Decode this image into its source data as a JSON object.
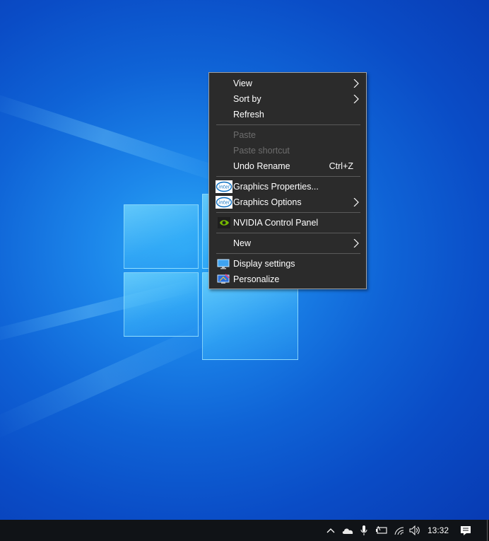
{
  "context_menu": {
    "items": [
      {
        "label": "View",
        "has_submenu": true,
        "enabled": true
      },
      {
        "label": "Sort by",
        "has_submenu": true,
        "enabled": true
      },
      {
        "label": "Refresh",
        "enabled": true
      },
      {
        "label": "Paste",
        "enabled": false
      },
      {
        "label": "Paste shortcut",
        "enabled": false
      },
      {
        "label": "Undo Rename",
        "accelerator": "Ctrl+Z",
        "enabled": true
      },
      {
        "label": "Graphics Properties...",
        "icon": "intel-icon",
        "enabled": true
      },
      {
        "label": "Graphics Options",
        "icon": "intel-icon",
        "has_submenu": true,
        "enabled": true
      },
      {
        "label": "NVIDIA Control Panel",
        "icon": "nvidia-icon",
        "enabled": true
      },
      {
        "label": "New",
        "has_submenu": true,
        "enabled": true
      },
      {
        "label": "Display settings",
        "icon": "display-icon",
        "enabled": true
      },
      {
        "label": "Personalize",
        "icon": "personalize-icon",
        "enabled": true
      }
    ]
  },
  "taskbar": {
    "clock": "13:32",
    "tray_icons": [
      "chevron-up-icon",
      "onedrive-cloud-icon",
      "microphone-icon",
      "battery-icon",
      "wifi-icon",
      "speaker-icon",
      "notification-icon"
    ]
  },
  "colors": {
    "menu_bg": "#2b2b2b",
    "menu_text": "#ffffff",
    "menu_disabled_text": "#6d6d6d",
    "taskbar_bg": "#101317",
    "desktop_blue": "#0f63d6"
  }
}
